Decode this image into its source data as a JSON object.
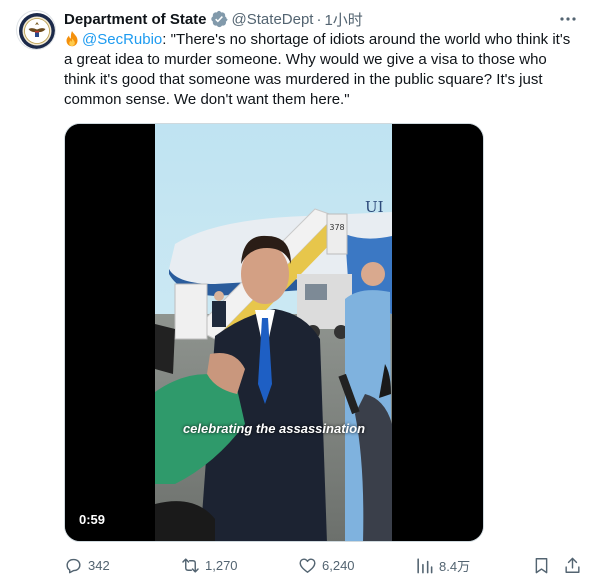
{
  "post": {
    "display_name": "Department of State",
    "handle": "@StateDept",
    "separator": "·",
    "time": "1小时",
    "text_prefix": "",
    "mention": "@SecRubio",
    "text_body": ": \"There's no shortage of idiots around the world who think it's a great idea to murder someone. Why would we give a visa to those who think it's good that someone was murdered in the public square? It's just common sense. We don't want them here.\""
  },
  "media": {
    "caption": "celebrating the assassination",
    "duration": "0:59",
    "aircraft_text": "UI",
    "stairs_text": "378"
  },
  "actions": {
    "replies": "342",
    "reposts": "1,270",
    "likes": "6,240",
    "views": "8.4万"
  },
  "colors": {
    "accent": "#1d9bf0",
    "secondary_text": "#536471",
    "verified_badge": "#829aab"
  },
  "icons": [
    "seal-avatar-icon",
    "verified-badge-icon",
    "more-icon",
    "fire-emoji-icon",
    "reply-icon",
    "repost-icon",
    "like-icon",
    "views-icon",
    "bookmark-icon",
    "share-icon"
  ]
}
